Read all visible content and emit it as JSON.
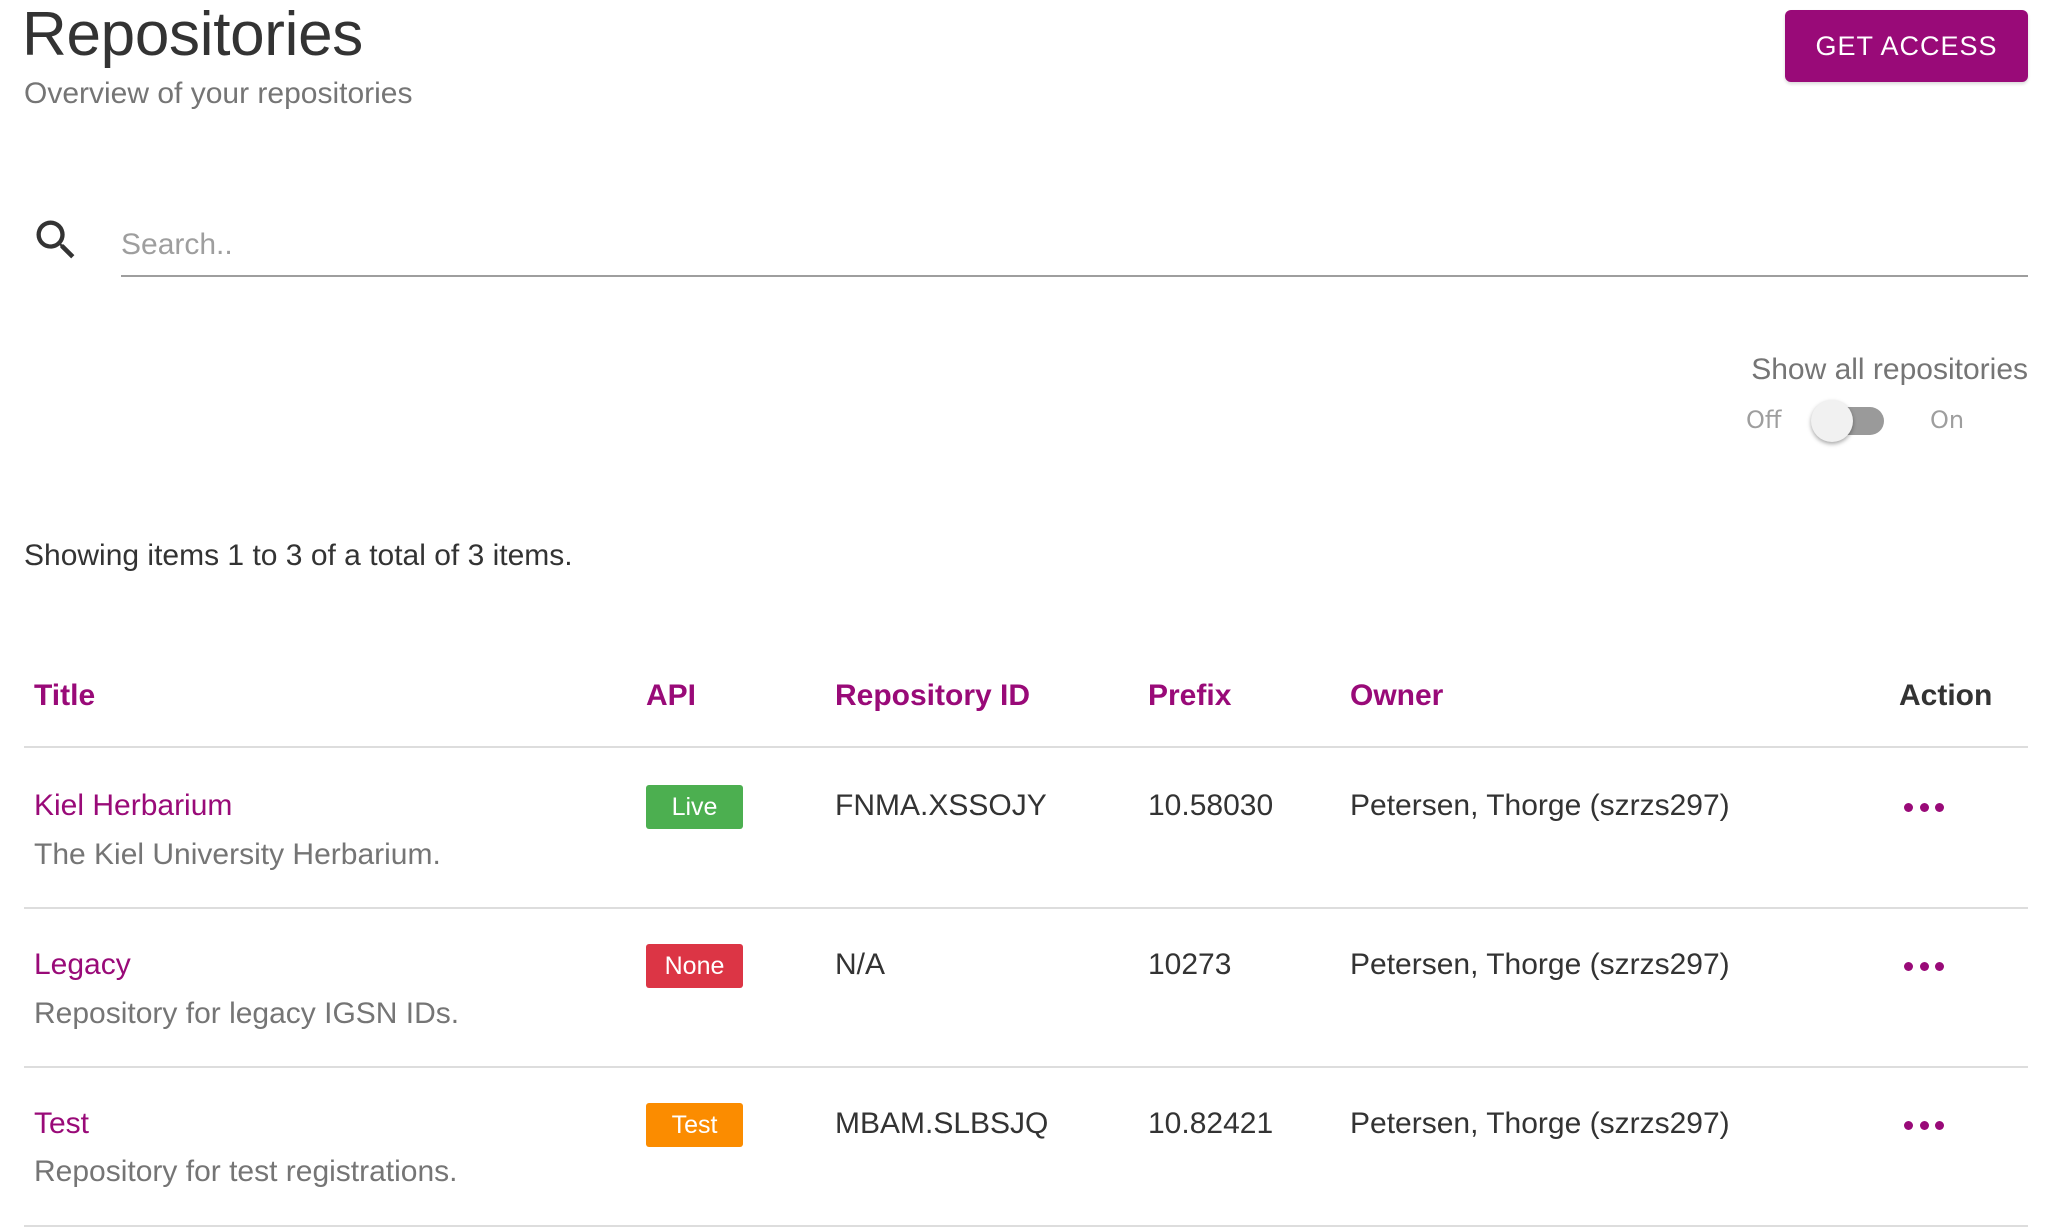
{
  "header": {
    "title": "Repositories",
    "subtitle": "Overview of your repositories",
    "get_access_label": "GET ACCESS"
  },
  "search": {
    "icon": "search-icon",
    "placeholder": "Search..",
    "value": ""
  },
  "filter": {
    "label": "Show all repositories",
    "off_label": "Off",
    "on_label": "On",
    "state": "off"
  },
  "summary": "Showing items 1 to 3 of a total of 3 items.",
  "table": {
    "columns": {
      "title": "Title",
      "api": "API",
      "repository_id": "Repository ID",
      "prefix": "Prefix",
      "owner": "Owner",
      "action": "Action"
    },
    "rows": [
      {
        "title": "Kiel Herbarium",
        "description": "The Kiel University Herbarium.",
        "api": "Live",
        "api_color": "#4caf50",
        "repository_id": "FNMA.XSSOJY",
        "prefix": "10.58030",
        "owner": "Petersen, Thorge (szrzs297)",
        "action_icon": "more-horizontal-icon"
      },
      {
        "title": "Legacy",
        "description": "Repository for legacy IGSN IDs.",
        "api": "None",
        "api_color": "#dc3545",
        "repository_id": "N/A",
        "prefix": "10273",
        "owner": "Petersen, Thorge (szrzs297)",
        "action_icon": "more-horizontal-icon"
      },
      {
        "title": "Test",
        "description": "Repository for test registrations.",
        "api": "Test",
        "api_color": "#fb8c00",
        "repository_id": "MBAM.SLBSJQ",
        "prefix": "10.82421",
        "owner": "Petersen, Thorge (szrzs297)",
        "action_icon": "more-horizontal-icon"
      }
    ]
  },
  "colors": {
    "accent": "#990a78",
    "text": "#333333",
    "muted": "#757575"
  }
}
